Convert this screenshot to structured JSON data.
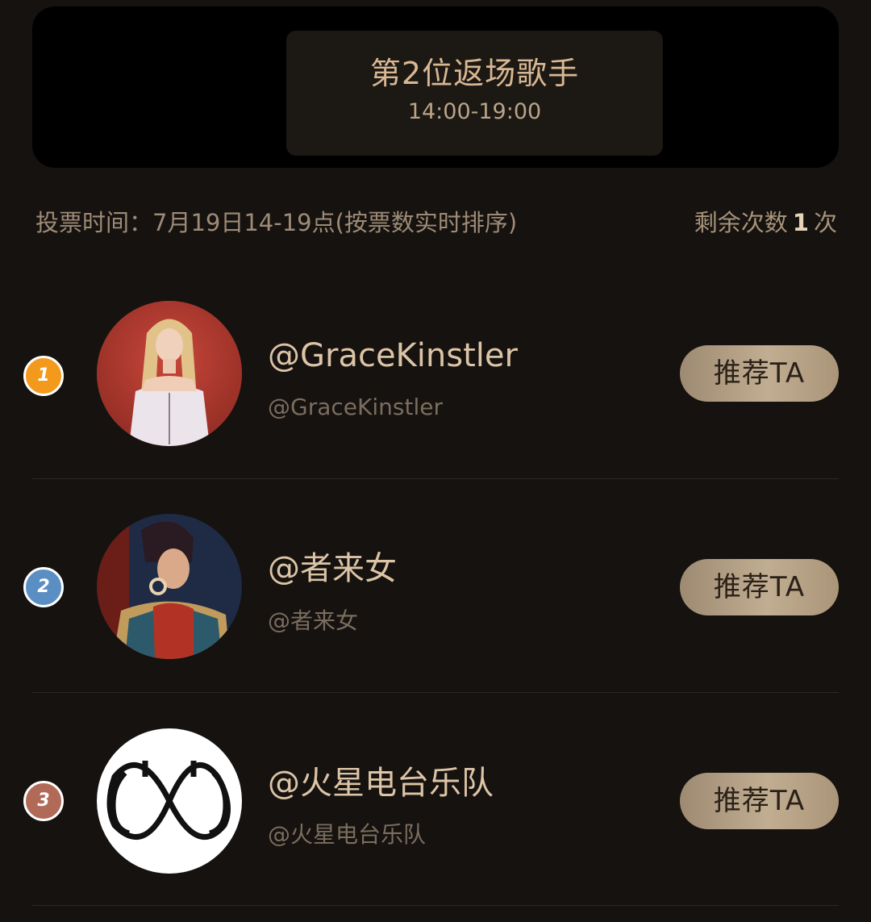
{
  "banner": {
    "title": "第2位返场歌手",
    "time": "14:00-19:00"
  },
  "vote": {
    "info": "投票时间：7月19日14-19点(按票数实时排序)",
    "remaining_prefix": "剩余次数",
    "remaining_count": "1",
    "remaining_suffix": "次"
  },
  "singers": [
    {
      "rank": "1",
      "rank_color": "#f39a1c",
      "name": "@GraceKinstler",
      "handle": "@GraceKinstler",
      "button": "推荐TA"
    },
    {
      "rank": "2",
      "rank_color": "#5b8fc4",
      "name": "@者来女",
      "handle": "@者来女",
      "button": "推荐TA"
    },
    {
      "rank": "3",
      "rank_color": "#b06a57",
      "name": "@火星电台乐队",
      "handle": "@火星电台乐队",
      "button": "推荐TA"
    }
  ]
}
